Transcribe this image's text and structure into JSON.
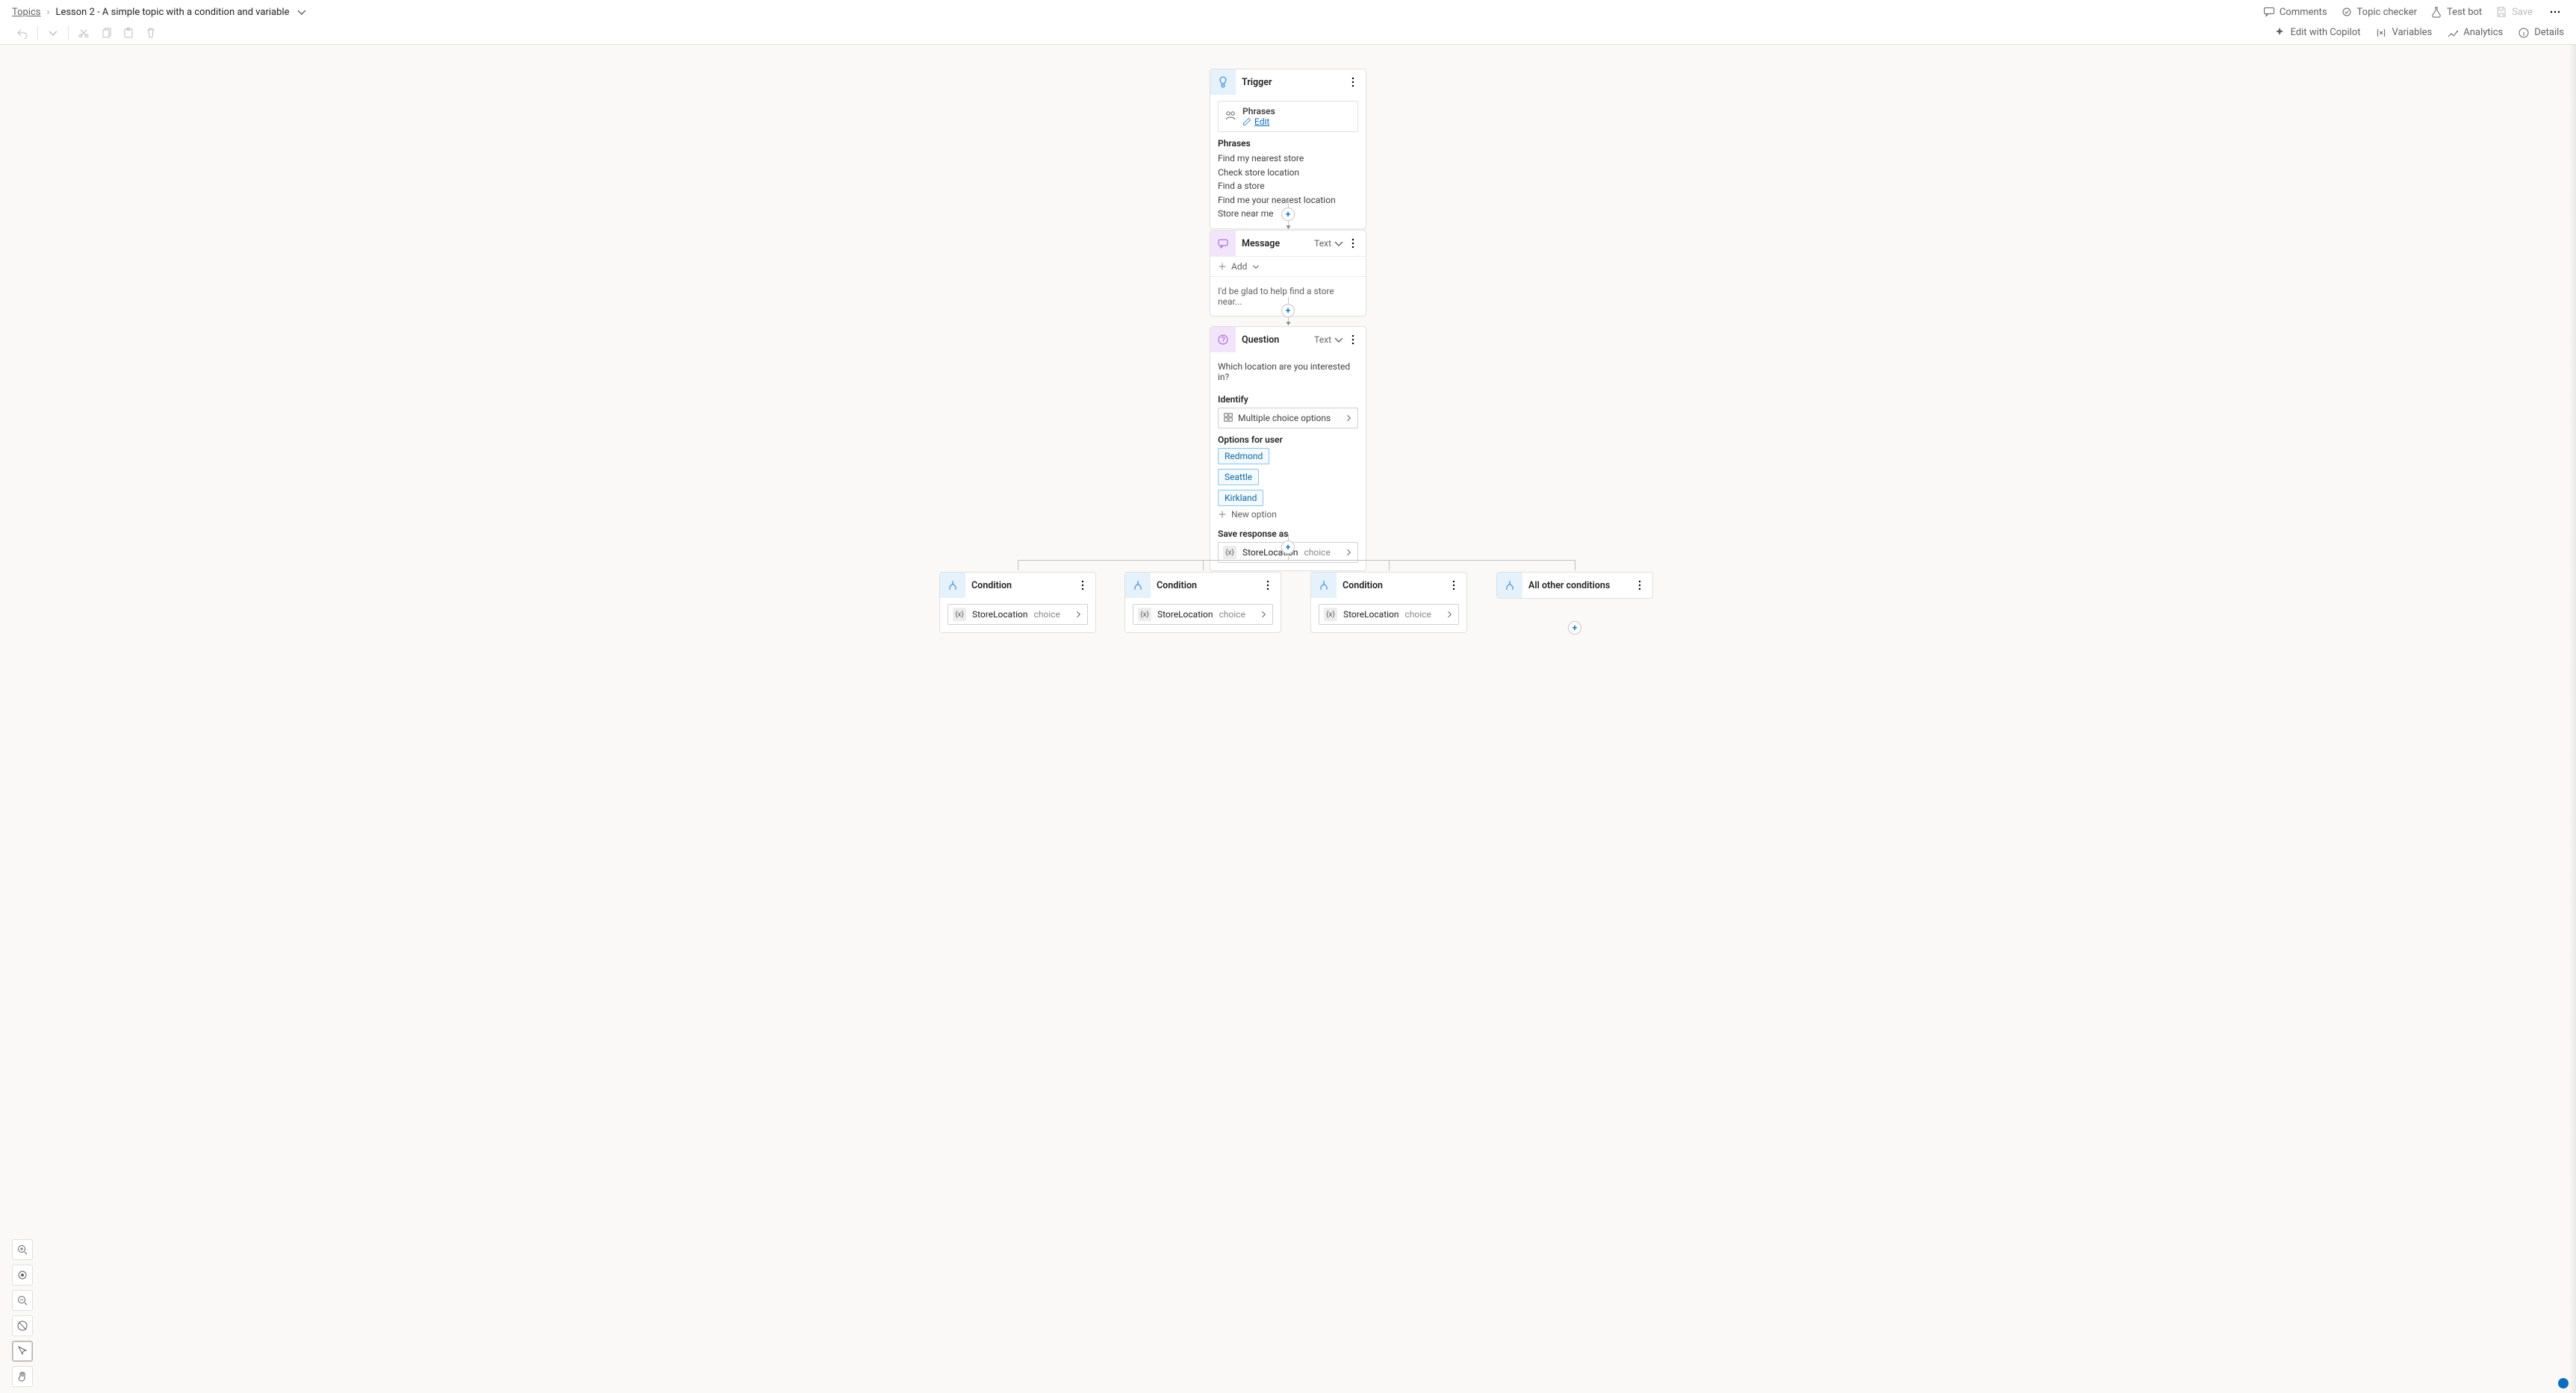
{
  "breadcrumb": {
    "root": "Topics",
    "current": "Lesson 2 - A simple topic with a condition and variable"
  },
  "topActions": {
    "comments": "Comments",
    "topic_checker": "Topic checker",
    "test_bot": "Test bot",
    "save": "Save"
  },
  "editTabs": {
    "edit_copilot": "Edit with Copilot",
    "variables": "Variables",
    "analytics": "Analytics",
    "details": "Details"
  },
  "zoom": {
    "tools": [
      "zoom-in",
      "fit",
      "zoom-out",
      "reset",
      "select",
      "pan"
    ],
    "active": "select"
  },
  "flow": {
    "trigger": {
      "title": "Trigger",
      "phrases_card_label": "Phrases",
      "edit_label": "Edit",
      "phrases_heading": "Phrases",
      "phrases": [
        "Find my nearest store",
        "Check store location",
        "Find a store",
        "Find me your nearest location",
        "Store near me"
      ]
    },
    "message": {
      "title": "Message",
      "type_label": "Text",
      "add_label": "Add",
      "text": "I'd be glad to help find a store near..."
    },
    "question": {
      "title": "Question",
      "type_label": "Text",
      "prompt": "Which location are you interested in?",
      "identify_label": "Identify",
      "identify_value": "Multiple choice options",
      "options_label": "Options for user",
      "options": [
        "Redmond",
        "Seattle",
        "Kirkland"
      ],
      "new_option_label": "New option",
      "save_as_label": "Save response as",
      "variable_name": "StoreLocation",
      "variable_type": "choice"
    },
    "conditions": [
      {
        "title": "Condition",
        "variable_name": "StoreLocation",
        "variable_type": "choice"
      },
      {
        "title": "Condition",
        "variable_name": "StoreLocation",
        "variable_type": "choice"
      },
      {
        "title": "Condition",
        "variable_name": "StoreLocation",
        "variable_type": "choice"
      },
      {
        "title": "All other conditions"
      }
    ]
  }
}
